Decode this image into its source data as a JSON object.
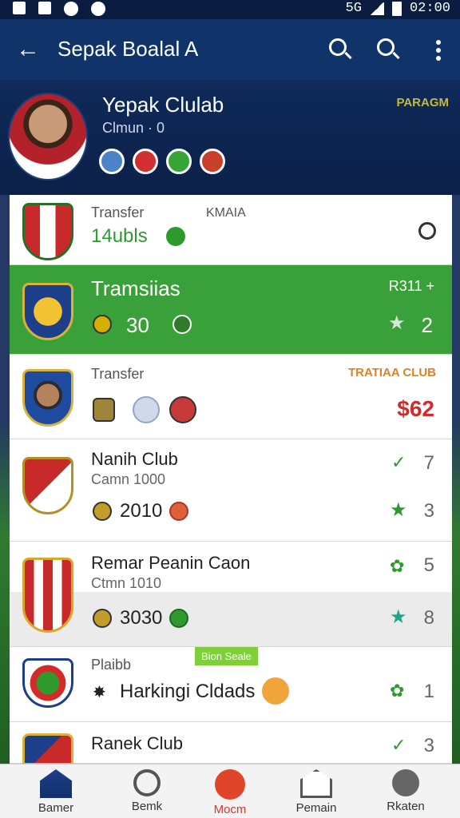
{
  "status": {
    "time": "02:00",
    "network": "5G"
  },
  "app_bar": {
    "title": "Sepak Boalal A"
  },
  "profile": {
    "name": "Yepak Clulab",
    "subtitle": "Clmun · 0",
    "tag": "PARAGM"
  },
  "cards": [
    {
      "title": "Transfer",
      "label": "KMAIA",
      "value": "14ubls",
      "accent": "#2e9a2e"
    },
    {
      "title": "Tramsiias",
      "value": "30",
      "right_label": "R311 +",
      "right_value": "2"
    },
    {
      "title": "Transfer",
      "right_label": "TRATIAA CLUB",
      "right_value": "$62"
    },
    {
      "title": "Nanih Club",
      "subtitle": "Camn 1000",
      "value": "2010",
      "r1": "7",
      "r2": "3"
    },
    {
      "title": "Remar Peanin Caon",
      "subtitle": "Ctmn 1010",
      "value": "3030",
      "r1": "5",
      "r2": "8"
    },
    {
      "title": "Plaibb",
      "badge": "Bion Seale",
      "subtitle": "Harkingi Cldads",
      "r1": "1"
    },
    {
      "title": "Ranek Club",
      "r1": "3"
    }
  ],
  "nav": [
    {
      "label": "Bamer"
    },
    {
      "label": "Bemk"
    },
    {
      "label": "Mocm"
    },
    {
      "label": "Pemain"
    },
    {
      "label": "Rkaten"
    }
  ]
}
